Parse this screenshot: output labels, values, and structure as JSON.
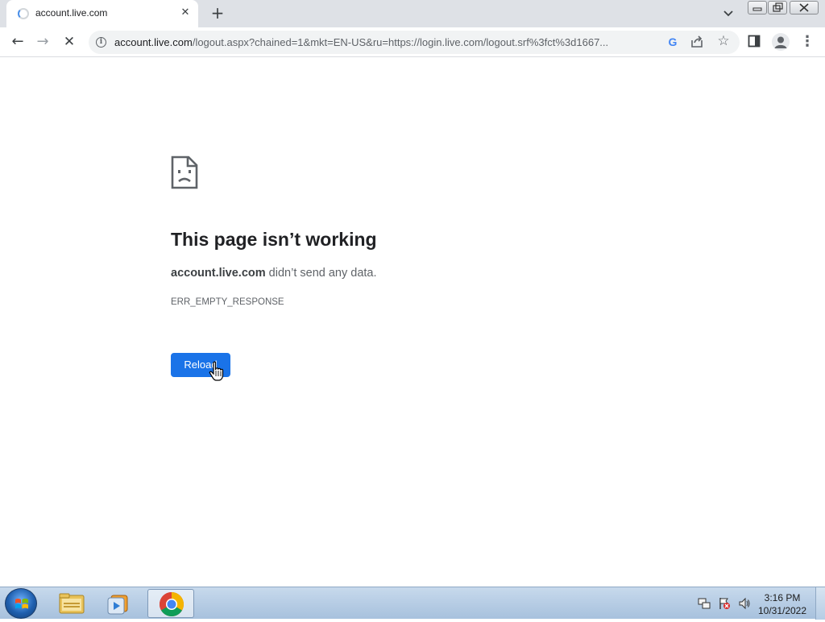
{
  "browser": {
    "tab": {
      "title": "account.live.com",
      "close_label": "✕"
    },
    "new_tab_label": "+",
    "tab_search_label": "⌄",
    "window_controls": {
      "minimize": "▭",
      "maximize": "⧉",
      "close": "✕"
    },
    "toolbar": {
      "back_label": "←",
      "forward_label": "→",
      "stop_label": "✕",
      "url_host": "account.live.com",
      "url_rest": "/logout.aspx?chained=1&mkt=EN-US&ru=https://login.live.com/logout.srf%3fct%3d1667...",
      "google_label": "G",
      "bookmark_label": "☆",
      "menu_label": "⋮"
    }
  },
  "error_page": {
    "title": "This page isn’t working",
    "host": "account.live.com",
    "message": " didn’t send any data.",
    "code": "ERR_EMPTY_RESPONSE",
    "reload_label": "Reload"
  },
  "taskbar": {
    "time": "3:16 PM",
    "date": "10/31/2022"
  },
  "colors": {
    "accent": "#1a73e8",
    "tabstrip": "#dee1e6",
    "omnibox": "#f1f3f4",
    "taskbar": "#b4cbe4"
  },
  "icons": [
    "loading-spinner",
    "info-icon",
    "google-icon",
    "share-icon",
    "star-icon",
    "side-panel-icon",
    "profile-icon",
    "menu-icon",
    "sad-page-icon",
    "hand-cursor",
    "windows-start-icon",
    "file-explorer-icon",
    "media-player-icon",
    "chrome-icon",
    "network-icon",
    "action-center-flag-icon",
    "volume-icon"
  ]
}
